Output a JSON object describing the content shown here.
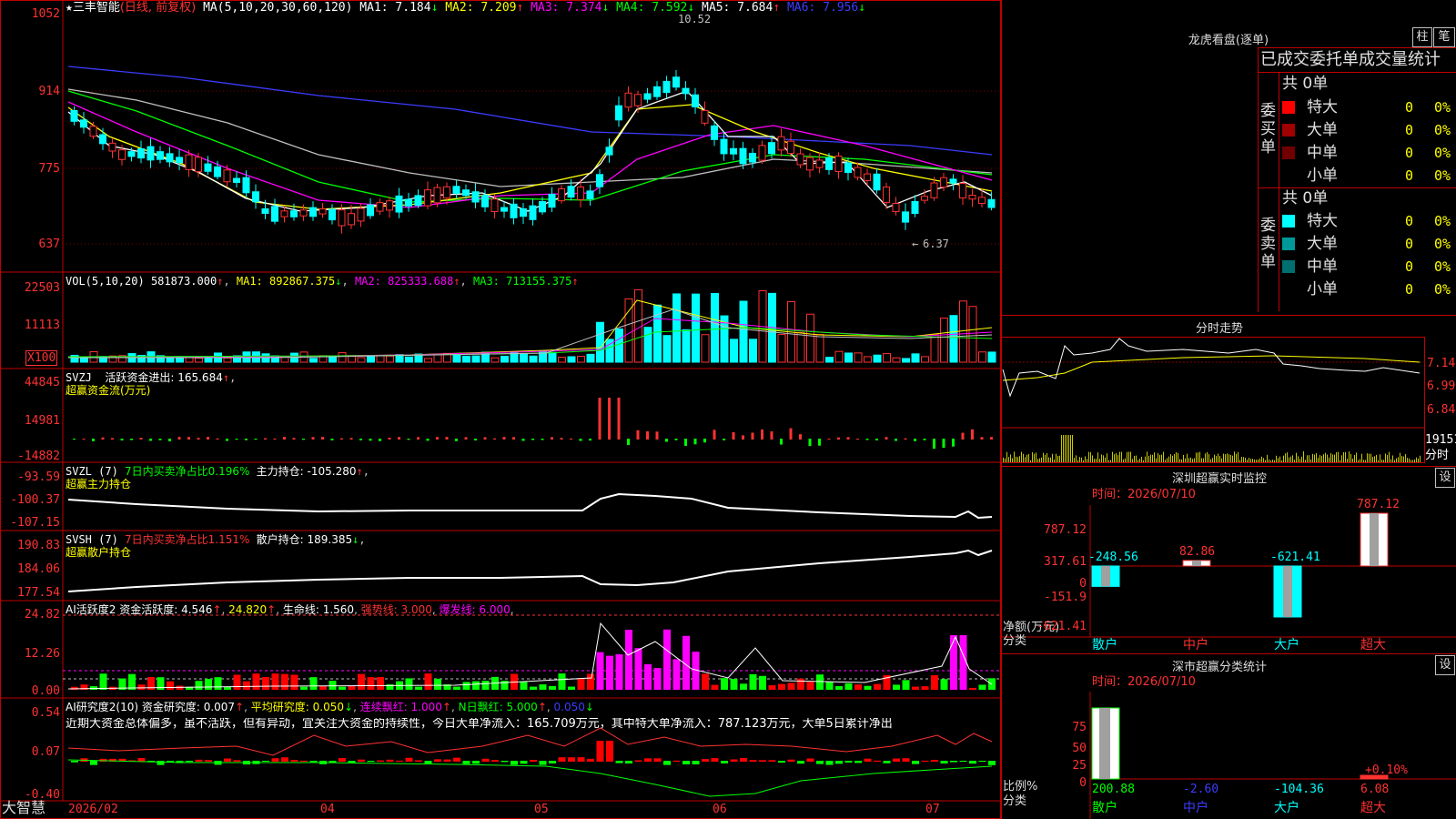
{
  "main_chart": {
    "star": "★",
    "stock_name": "三丰智能",
    "period": "(日线, 前复权)",
    "ma_params": "MA(5,10,20,30,60,120)",
    "ma": [
      {
        "label": "MA1: 7.184",
        "arrow": "↓",
        "color": "#ffffff"
      },
      {
        "label": "MA2: 7.209",
        "arrow": "↑",
        "color": "#ffff00"
      },
      {
        "label": "MA3: 7.374",
        "arrow": "↓",
        "color": "#ff00ff"
      },
      {
        "label": "MA4: 7.592",
        "arrow": "↓",
        "color": "#00ff00"
      },
      {
        "label": "MA5: 7.684",
        "arrow": "↑",
        "color": "#c0c0c0"
      },
      {
        "label": "MA6: 7.956",
        "arrow": "↓",
        "color": "#3c3cff"
      }
    ],
    "high_mark": "10.52",
    "low_mark": "6.37",
    "y_ticks": [
      "1052",
      "914",
      "775",
      "637"
    ]
  },
  "vol_panel": {
    "title": "VOL(5,10,20)",
    "value": "581873.000",
    "ma1": "MA1: 892867.375",
    "ma2": "MA2: 825333.688",
    "ma3": "MA3: 713155.375",
    "y_ticks": [
      "22503",
      "11113"
    ],
    "unit": "X100"
  },
  "svzj_panel": {
    "title": "SVZJ",
    "value": "活跃资金进出: 165.684",
    "sub": "超赢资金流(万元)",
    "y_ticks": [
      "44845",
      "14981",
      "-14882"
    ]
  },
  "svzl_panel": {
    "title": "SVZL (7)",
    "desc": "7日内买卖净占比0.196%",
    "value": "主力持仓: -105.280",
    "sub": "超赢主力持仓",
    "y_ticks": [
      "-93.59",
      "-100.37",
      "-107.15"
    ]
  },
  "svsh_panel": {
    "title": "SVSH (7)",
    "desc": "7日内买卖净占比1.151%",
    "value": "散户持仓: 189.385",
    "sub": "超赢散户持仓",
    "y_ticks": [
      "190.83",
      "184.06",
      "177.54"
    ]
  },
  "ai_active_panel": {
    "title": "AI活跃度2",
    "value": "资金活跃度: 4.546",
    "v2": "24.820",
    "life": "生命线: 1.560",
    "strong": "强势线: 3.000",
    "burst": "爆发线: 6.000",
    "y_ticks": [
      "24.82",
      "12.26",
      "0.00"
    ]
  },
  "ai_research_panel": {
    "title": "AI研究度2(10)",
    "value": "资金研究度: 0.007",
    "avg": "平均研究度: 0.050",
    "red": "连续飘红: 1.000",
    "n_red": "N日飘红: 5.000",
    "v5": "0.050",
    "comment": "近期大资金总体偏多，虽不活跃，但有异动，宜关注大资金的持续性，今日大单净流入：165.709万元，其中特大单净流入：787.123万元，大单5日累计净出",
    "y_ticks": [
      "0.54",
      "0.07",
      "-0.40"
    ]
  },
  "x_axis": {
    "brand": "大智慧",
    "labels": [
      "2026/02",
      "04",
      "05",
      "06",
      "07"
    ]
  },
  "dragon_tiger": {
    "title": "龙虎看盘(逐单)",
    "tab_bar": "柱",
    "tab_pen": "笔",
    "header": "已成交委托单成交量统计",
    "buy_label": "委买单",
    "sell_label": "委卖单",
    "buy_total": "共 0单",
    "sell_total": "共 0单",
    "buy_rows": [
      {
        "name": "特大",
        "color": "#ff0000",
        "v": "0",
        "p": "0%"
      },
      {
        "name": "大单",
        "color": "#a00000",
        "v": "0",
        "p": "0%"
      },
      {
        "name": "中单",
        "color": "#700000",
        "v": "0",
        "p": "0%"
      },
      {
        "name": "小单",
        "color": "",
        "v": "0",
        "p": "0%"
      }
    ],
    "sell_rows": [
      {
        "name": "特大",
        "color": "#00ffff",
        "v": "0",
        "p": "0%"
      },
      {
        "name": "大单",
        "color": "#009999",
        "v": "0",
        "p": "0%"
      },
      {
        "name": "中单",
        "color": "#006f6f",
        "v": "0",
        "p": "0%"
      },
      {
        "name": "小单",
        "color": "",
        "v": "0",
        "p": "0%"
      }
    ]
  },
  "intraday": {
    "title": "分时走势",
    "prices": [
      "7.14",
      "6.99",
      "6.84"
    ],
    "vol": "19151",
    "vol_label": "分时"
  },
  "sz_monitor": {
    "title": "深圳超赢实时监控",
    "set": "设",
    "time": "时间：2026/07/10",
    "unit": "净额(万元)",
    "cat_label": "分类",
    "y_ticks": [
      "787.12",
      "317.61",
      "0",
      "-151.9",
      "-621.41"
    ],
    "chart_data": {
      "type": "bar",
      "categories": [
        "散户",
        "中户",
        "大户",
        "超大"
      ],
      "values": [
        -248.56,
        82.86,
        -621.41,
        787.12
      ],
      "ylim": [
        -621.41,
        787.12
      ]
    }
  },
  "sz_class": {
    "title": "深市超赢分类统计",
    "set": "设",
    "time": "时间：2026/07/10",
    "unit": "比例%",
    "cat_label": "分类",
    "y_ticks": [
      "75",
      "50",
      "25",
      "0"
    ],
    "note": "+0.10%",
    "chart_data": {
      "type": "bar",
      "categories": [
        "散户",
        "中户",
        "大户",
        "超大"
      ],
      "values": [
        200.88,
        -2.6,
        -104.36,
        6.08
      ]
    }
  }
}
